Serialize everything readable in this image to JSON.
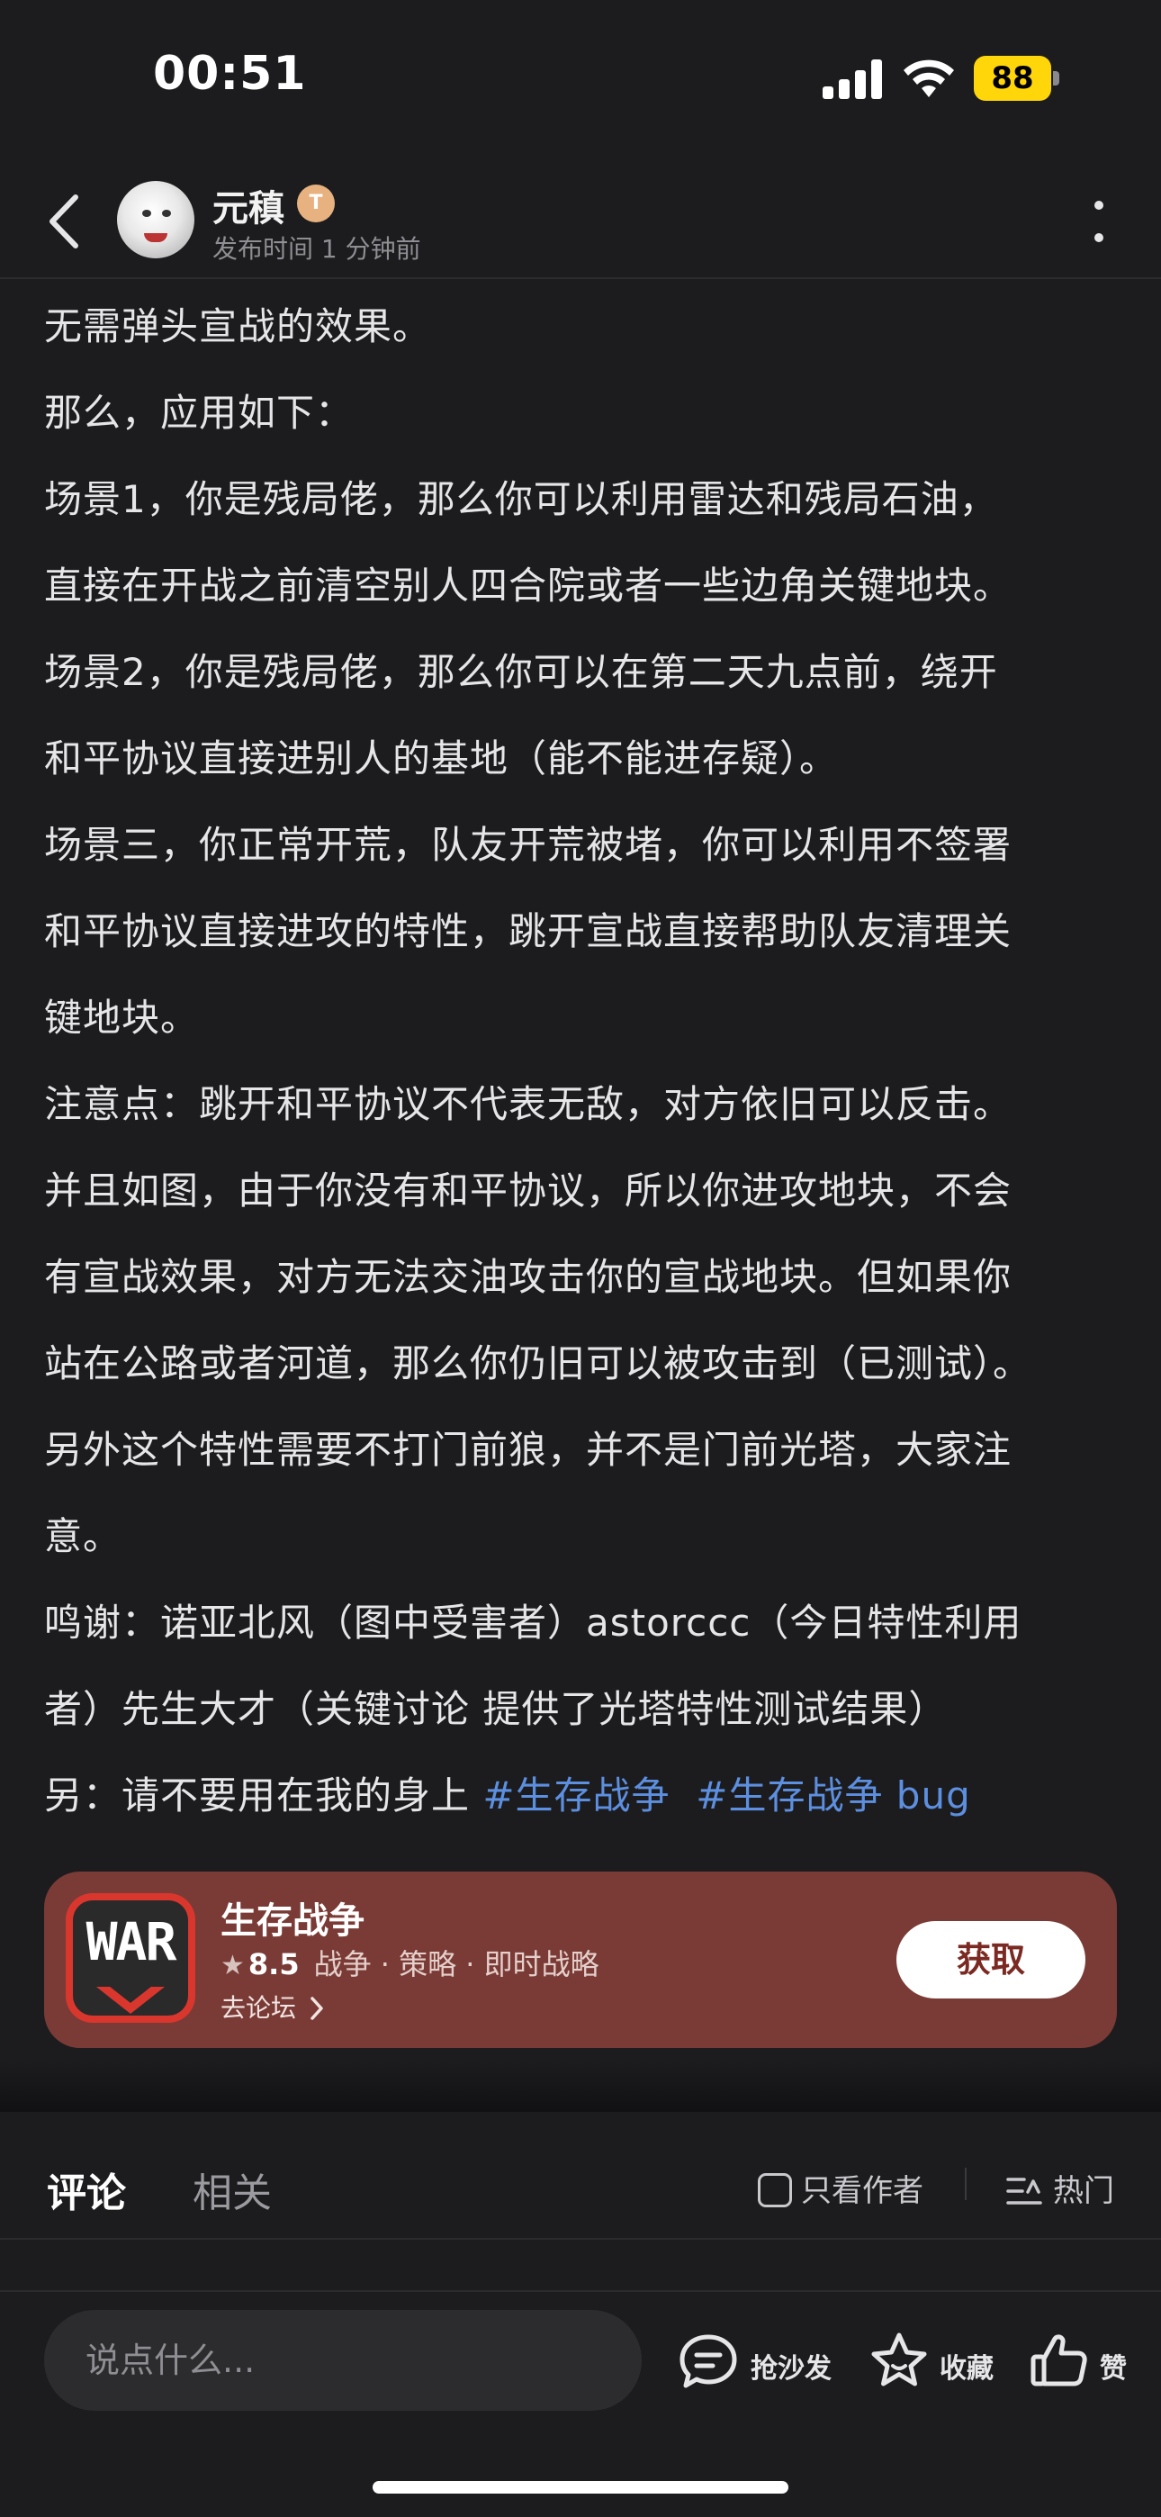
{
  "status_bar": {
    "time": "00:51",
    "battery": "88",
    "icons": [
      "signal-icon",
      "wifi-icon",
      "battery-icon"
    ]
  },
  "header": {
    "back_icon": "chevron-left-icon",
    "author": "元稹",
    "level_badge": "T",
    "post_time": "发布时间 1 分钟前",
    "more_icon": "more-vertical-icon"
  },
  "post": {
    "paragraphs": [
      "无需弹头宣战的效果。",
      "那么，应用如下：",
      "场景1，你是残局佬，那么你可以利用雷达和残局石油，",
      "直接在开战之前清空别人四合院或者一些边角关键地块。",
      "场景2，你是残局佬，那么你可以在第二天九点前，绕开",
      "和平协议直接进别人的基地（能不能进存疑）。",
      "场景三，你正常开荒，队友开荒被堵，你可以利用不签署",
      "和平协议直接进攻的特性，跳开宣战直接帮助队友清理关",
      "键地块。",
      "注意点：跳开和平协议不代表无敌，对方依旧可以反击。",
      "并且如图，由于你没有和平协议，所以你进攻地块，不会",
      "有宣战效果，对方无法交油攻击你的宣战地块。但如果你",
      "站在公路或者河道，那么你仍旧可以被攻击到（已测试）。",
      "另外这个特性需要不打门前狼，并不是门前光塔，大家注",
      "意。",
      "鸣谢：诺亚北风（图中受害者）astorccc（今日特性利用",
      "者）先生大才（关键讨论 提供了光塔特性测试结果）"
    ],
    "last_line_prefix": "另：请不要用在我的身上 ",
    "hashtags": [
      "#生存战争",
      "#生存战争 bug"
    ]
  },
  "app_card": {
    "icon_text": "WAR",
    "name": "生存战争",
    "rating": "8.5",
    "tags": "战争 · 策略 · 即时战略",
    "forum_link": "去论坛",
    "get_button": "获取",
    "bg_color": "#7a3b36"
  },
  "tabs": {
    "items": [
      "评论",
      "相关"
    ],
    "active": "评论",
    "author_only": "只看作者",
    "sort": "热门",
    "accent": "#1ec8a5"
  },
  "bottom_bar": {
    "input_placeholder": "说点什么...",
    "sofa": "抢沙发",
    "favorite": "收藏",
    "like": "赞"
  }
}
